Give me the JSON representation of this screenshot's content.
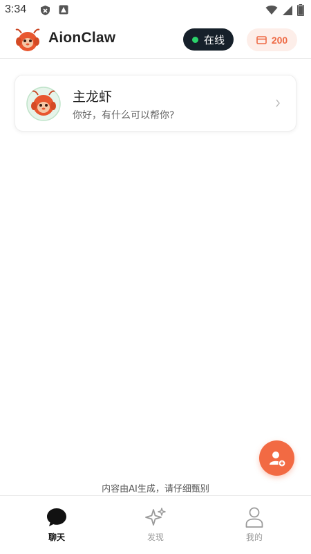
{
  "status_bar": {
    "time": "3:34"
  },
  "header": {
    "app_title": "AionClaw",
    "status_label": "在线",
    "credits": "200"
  },
  "contacts": [
    {
      "name": "主龙虾",
      "preview": "你好，有什么可以帮你?"
    }
  ],
  "disclaimer": "内容由AI生成，请仔细甄别",
  "bottom_nav": {
    "items": [
      {
        "label": "聊天",
        "icon": "chat-bubble-icon",
        "active": true
      },
      {
        "label": "发现",
        "icon": "sparkle-icon",
        "active": false
      },
      {
        "label": "我的",
        "icon": "person-icon",
        "active": false
      }
    ]
  },
  "colors": {
    "accent": "#f26a43",
    "online_dot": "#2bd36b",
    "dark_pill": "#16202a",
    "credits_bg": "#fdeee9"
  }
}
